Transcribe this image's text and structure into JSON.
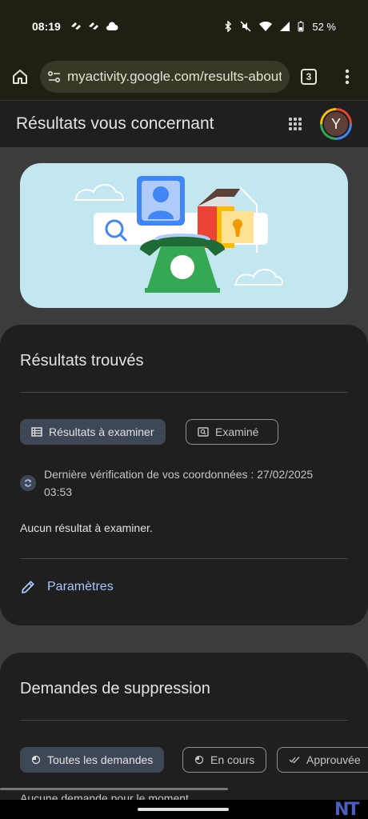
{
  "status_bar": {
    "time": "08:19",
    "battery": "52 %"
  },
  "browser": {
    "url": "myactivity.google.com/results-about-you",
    "tab_count": "3"
  },
  "header": {
    "title": "Résultats vous concernant",
    "avatar_letter": "Y"
  },
  "results_card": {
    "title": "Résultats trouvés",
    "chips": [
      {
        "label": "Résultats à examiner",
        "icon": "list-icon",
        "selected": true
      },
      {
        "label": "Examiné",
        "icon": "search-image-icon",
        "selected": false
      }
    ],
    "last_check": "Dernière vérification de vos coordonnées : 27/02/2025 03:53",
    "empty_message": "Aucun résultat à examiner.",
    "settings_label": "Paramètres"
  },
  "removal_card": {
    "title": "Demandes de suppression",
    "chips": [
      {
        "label": "Toutes les demandes",
        "icon": "pie-icon",
        "selected": true
      },
      {
        "label": "En cours",
        "icon": "pie-icon",
        "selected": false
      },
      {
        "label": "Approuvée",
        "icon": "double-check-icon",
        "selected": false
      }
    ],
    "empty_message": "Aucune demande pour le moment"
  },
  "colors": {
    "accent": "#a8c7fa",
    "chip_selected": "#3e4756",
    "surface": "#1f1f1f",
    "background": "#3c3c3c"
  },
  "watermark": "NT"
}
